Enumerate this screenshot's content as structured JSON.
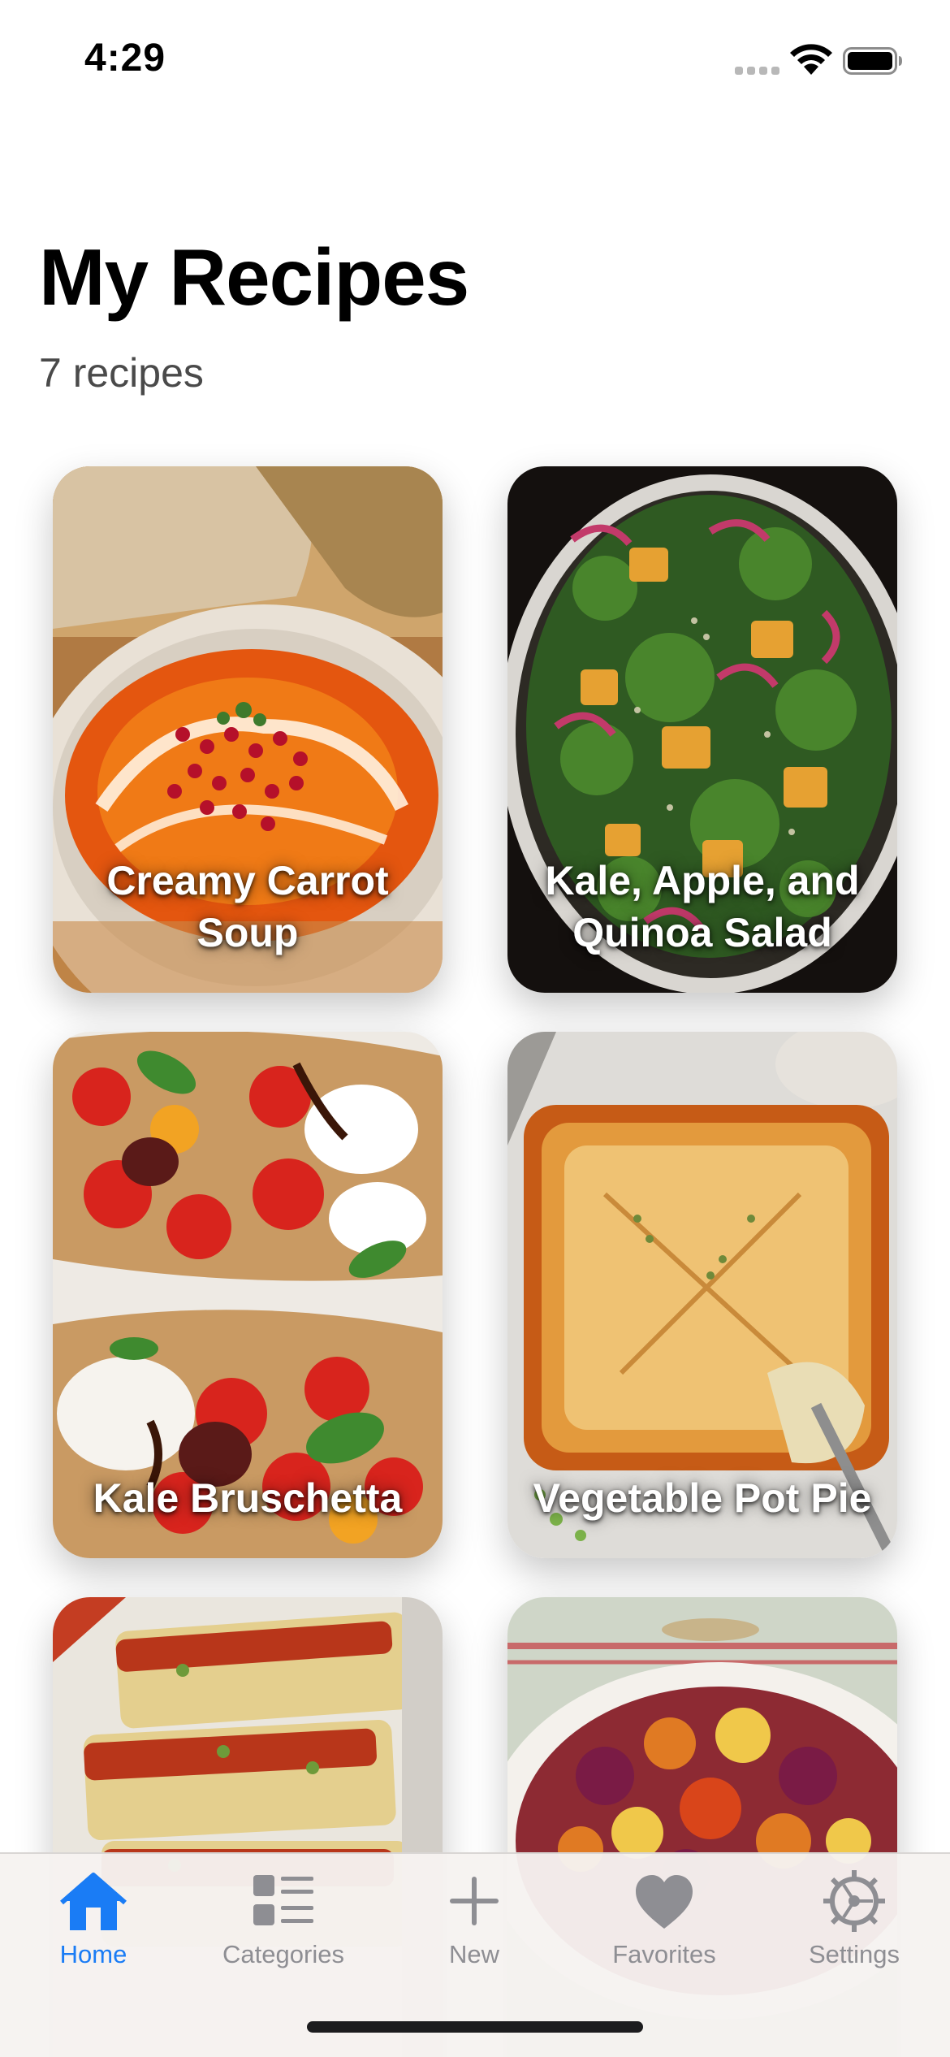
{
  "status_bar": {
    "time": "4:29",
    "icons": [
      "cellular-signal-icon",
      "wifi-icon",
      "battery-icon"
    ]
  },
  "header": {
    "title": "My Recipes",
    "subtitle": "7 recipes"
  },
  "recipes": [
    {
      "title": "Creamy Carrot Soup",
      "image": "carrot-soup-photo"
    },
    {
      "title": "Kale, Apple, and Quinoa Salad",
      "image": "kale-quinoa-salad-photo"
    },
    {
      "title": "Kale Bruschetta",
      "image": "kale-bruschetta-photo"
    },
    {
      "title": "Vegetable Pot Pie",
      "image": "vegetable-pot-pie-photo"
    },
    {
      "title": "",
      "image": "vegetable-loaf-photo"
    },
    {
      "title": "",
      "image": "roasted-vegetables-photo"
    }
  ],
  "tab_bar": {
    "tabs": [
      {
        "label": "Home",
        "icon": "house-icon",
        "active": true
      },
      {
        "label": "Categories",
        "icon": "list-icon",
        "active": false
      },
      {
        "label": "New",
        "icon": "plus-icon",
        "active": false
      },
      {
        "label": "Favorites",
        "icon": "heart-icon",
        "active": false
      },
      {
        "label": "Settings",
        "icon": "gear-icon",
        "active": false
      }
    ]
  },
  "colors": {
    "accent": "#1a7cf5",
    "inactive_tab": "#8e8e93",
    "title_text": "#000000",
    "subtitle_text": "#4a4a4a"
  }
}
